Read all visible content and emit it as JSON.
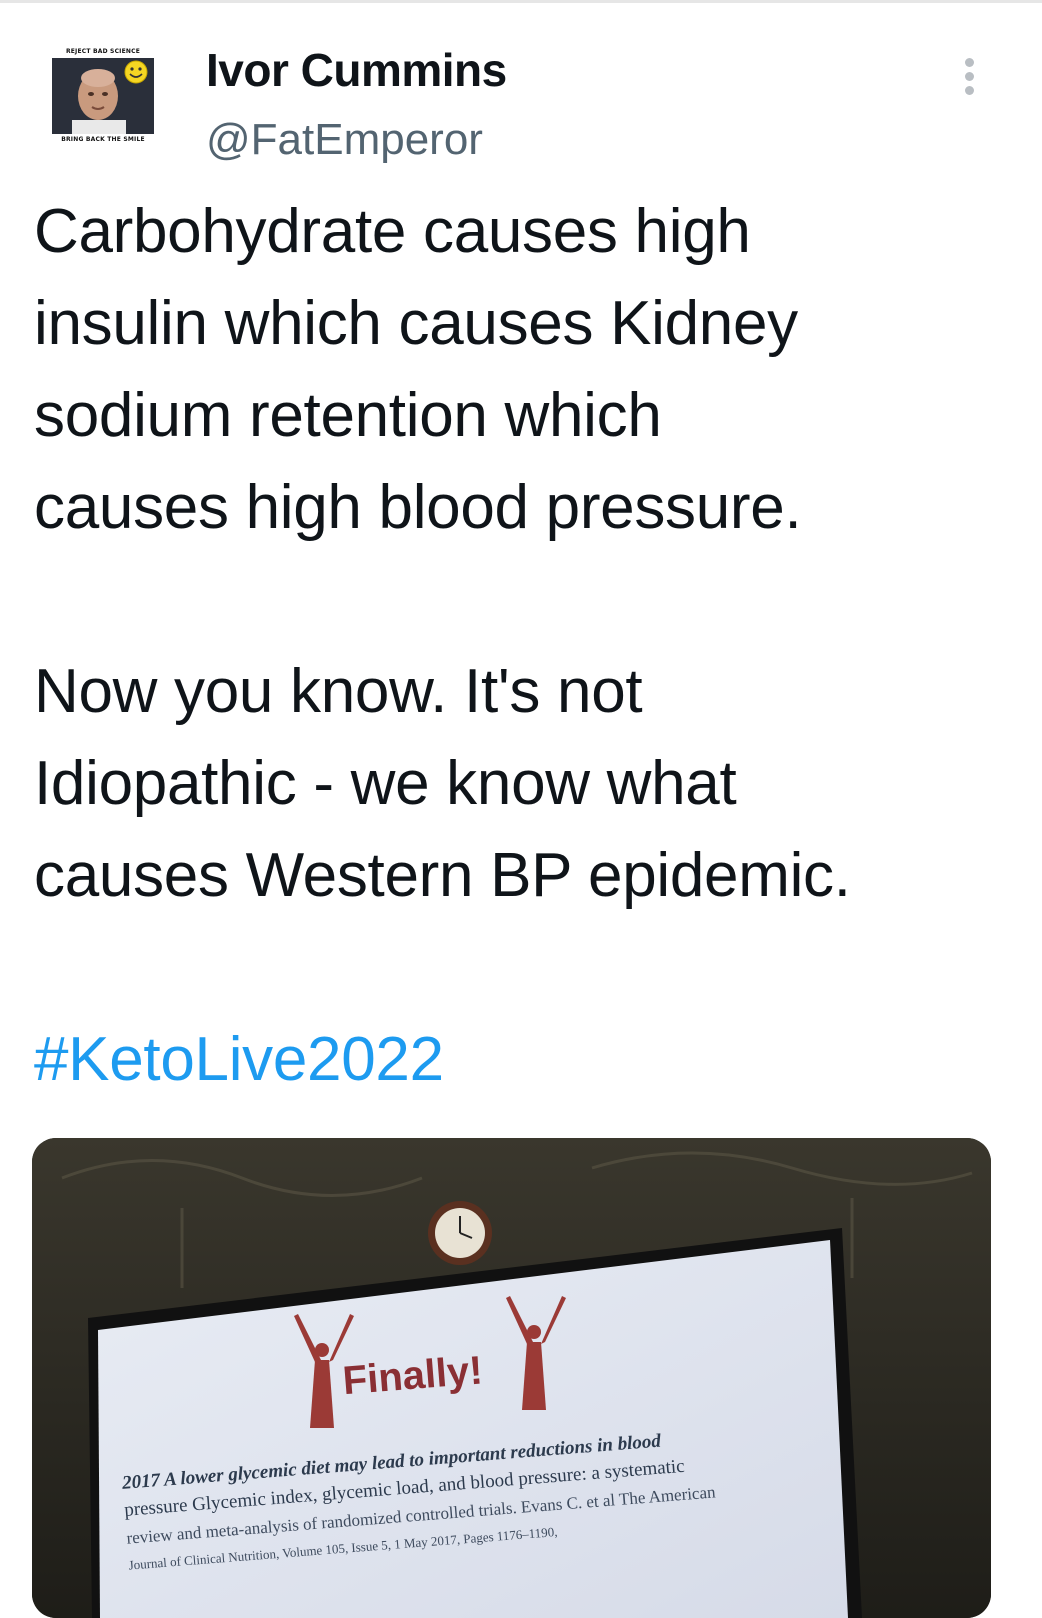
{
  "tweet": {
    "author_name": "Ivor Cummins",
    "author_handle": "@FatEmperor",
    "avatar": {
      "top_text": "REJECT BAD SCIENCE",
      "bottom_text": "BRING BACK THE SMILE"
    },
    "paragraphs": [
      "Carbohydrate causes high\ninsulin which causes Kidney\nsodium retention which\ncauses high blood pressure.",
      "Now you know. It's not\nIdiopathic - we know what\ncauses Western BP epidemic."
    ],
    "hashtag": "#KetoLive2022"
  },
  "media": {
    "slide": {
      "headline": "Finally!",
      "citation_lines": [
        "2017 A lower glycemic diet may lead to important reductions in blood",
        "pressure  Glycemic index, glycemic load, and blood pressure: a systematic",
        "review and meta-analysis of randomized controlled trials. Evans C. et al The American",
        "Journal of Clinical Nutrition, Volume 105, Issue 5, 1 May 2017, Pages 1176–1190,"
      ]
    }
  },
  "icons": {
    "more": "more-vertical-icon",
    "avatar_smiley": "smiley-icon",
    "clock": "clock-icon"
  },
  "colors": {
    "text": "#0f1419",
    "secondary_text": "#536471",
    "link": "#1d9bf0",
    "more_icon": "#b9bec3"
  }
}
